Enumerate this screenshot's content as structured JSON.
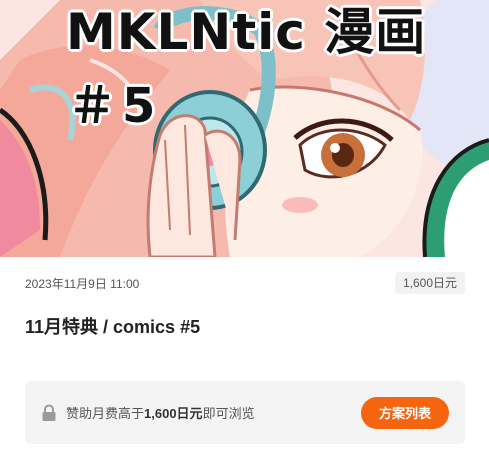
{
  "post": {
    "cover": {
      "title_text": "MKLNtic 漫画",
      "number_text": "＃5",
      "description_icon": "manga-cover-artwork"
    },
    "date": "2023年11月9日 11:00",
    "price_badge": "1,600日元",
    "title": "11月特典 / comics #5"
  },
  "lock_panel": {
    "icon": "lock-icon",
    "text_prefix": "赞助月费高于",
    "text_amount": "1,600日元",
    "text_suffix": "即可浏览",
    "plan_button_label": "方案列表"
  },
  "colors": {
    "accent": "#f5640f",
    "panel_bg": "#f4f4f4",
    "badge_bg": "#f2f2f2"
  }
}
